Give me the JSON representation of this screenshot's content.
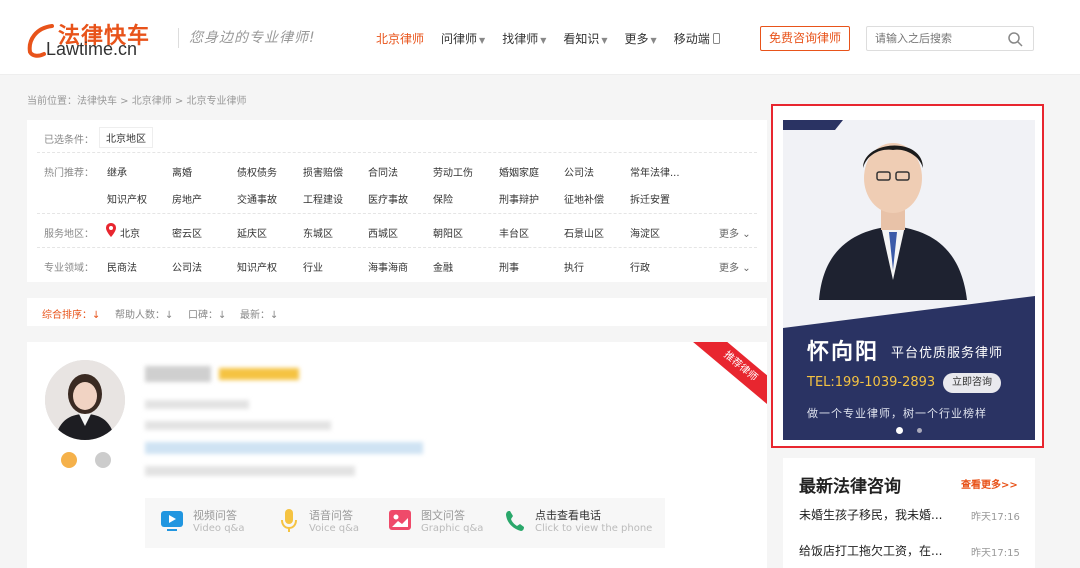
{
  "header": {
    "logo_cn": "法律快车",
    "logo_en": "Lawtime.cn",
    "slogan": "您身边的专业律师!",
    "nav": [
      {
        "label": "北京律师",
        "active": true,
        "caret": false
      },
      {
        "label": "问律师",
        "active": false,
        "caret": true
      },
      {
        "label": "找律师",
        "active": false,
        "caret": true
      },
      {
        "label": "看知识",
        "active": false,
        "caret": true
      },
      {
        "label": "更多",
        "active": false,
        "caret": true
      },
      {
        "label": "移动端",
        "active": false,
        "caret": false
      }
    ],
    "consult_button": "免费咨询律师",
    "search_placeholder": "请输入之后搜索"
  },
  "breadcrumb": "当前位置：法律快车 > 北京律师 > 北京专业律师",
  "filters": {
    "selected_label": "已选条件：",
    "selected_value": "北京地区",
    "hot_label": "热门推荐：",
    "hot_row1": [
      "继承",
      "离婚",
      "债权债务",
      "损害赔偿",
      "合同法",
      "劳动工伤",
      "婚姻家庭",
      "公司法",
      "常年法律..."
    ],
    "hot_row2": [
      "知识产权",
      "房地产",
      "交通事故",
      "工程建设",
      "医疗事故",
      "保险",
      "刑事辩护",
      "征地补偿",
      "拆迁安置"
    ],
    "area_label": "服务地区：",
    "areas": [
      "北京",
      "密云区",
      "延庆区",
      "东城区",
      "西城区",
      "朝阳区",
      "丰台区",
      "石景山区",
      "海淀区"
    ],
    "field_label": "专业领域：",
    "fields": [
      "民商法",
      "公司法",
      "知识产权",
      "行业",
      "海事海商",
      "金融",
      "刑事",
      "执行",
      "行政"
    ],
    "more": "更多"
  },
  "sort": [
    {
      "label": "综合排序：",
      "active": true
    },
    {
      "label": "帮助人数：",
      "active": false
    },
    {
      "label": "口碑：",
      "active": false
    },
    {
      "label": "最新：",
      "active": false
    }
  ],
  "card": {
    "ribbon": "推荐律师",
    "qa": [
      {
        "title": "视频问答",
        "sub": "Video q&a",
        "icon": "video-icon"
      },
      {
        "title": "语音问答",
        "sub": "Voice q&a",
        "icon": "mic-icon"
      },
      {
        "title": "图文问答",
        "sub": "Graphic q&a",
        "icon": "image-icon"
      },
      {
        "title": "点击查看电话",
        "sub": "Click to view the phone",
        "icon": "phone-icon"
      }
    ]
  },
  "banner": {
    "name": "怀向阳",
    "role": "平台优质服务律师",
    "tel": "TEL:199-1039-2893",
    "button": "立即咨询",
    "slogan": "做一个专业律师，树一个行业榜样"
  },
  "latest": {
    "title": "最新法律咨询",
    "more": "查看更多>>",
    "items": [
      {
        "text": "未婚生孩子移民，我未婚...",
        "time": "昨天17:16"
      },
      {
        "text": "给饭店打工拖欠工资，在...",
        "time": "昨天17:15"
      }
    ]
  },
  "colors": {
    "accent": "#e8531a",
    "highlight": "#e8262f",
    "navy": "#2a3363",
    "gold": "#f5c342"
  }
}
